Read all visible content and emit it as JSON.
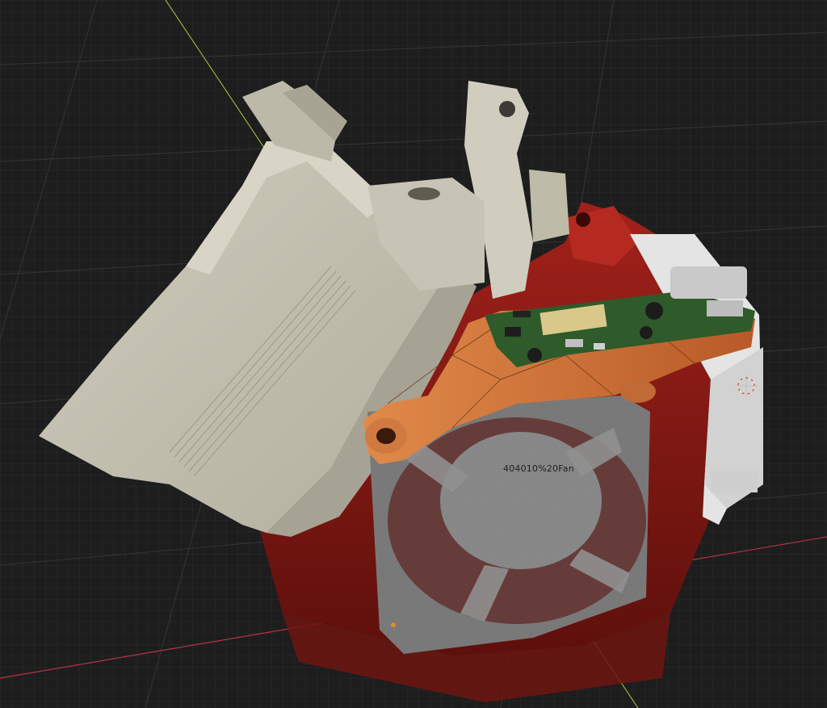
{
  "viewport": {
    "object_label": "404010%20Fan",
    "colors": {
      "background": "#1c1c1c",
      "grid_line": "#3a3a3a",
      "x_axis": "#b8343e",
      "y_axis": "#8fb43a",
      "motor_body": "#c8c5b6",
      "housing_red": "#8e1b14",
      "shroud_white": "#e6e6e6",
      "bracket_copper": "#d9783e",
      "pcb_green": "#2f5a2a",
      "fan_gray": "#8a8a8a",
      "origin_marker": "#e88a2a"
    },
    "icons": [
      "3d-cursor-icon",
      "object-origin-icon"
    ]
  }
}
